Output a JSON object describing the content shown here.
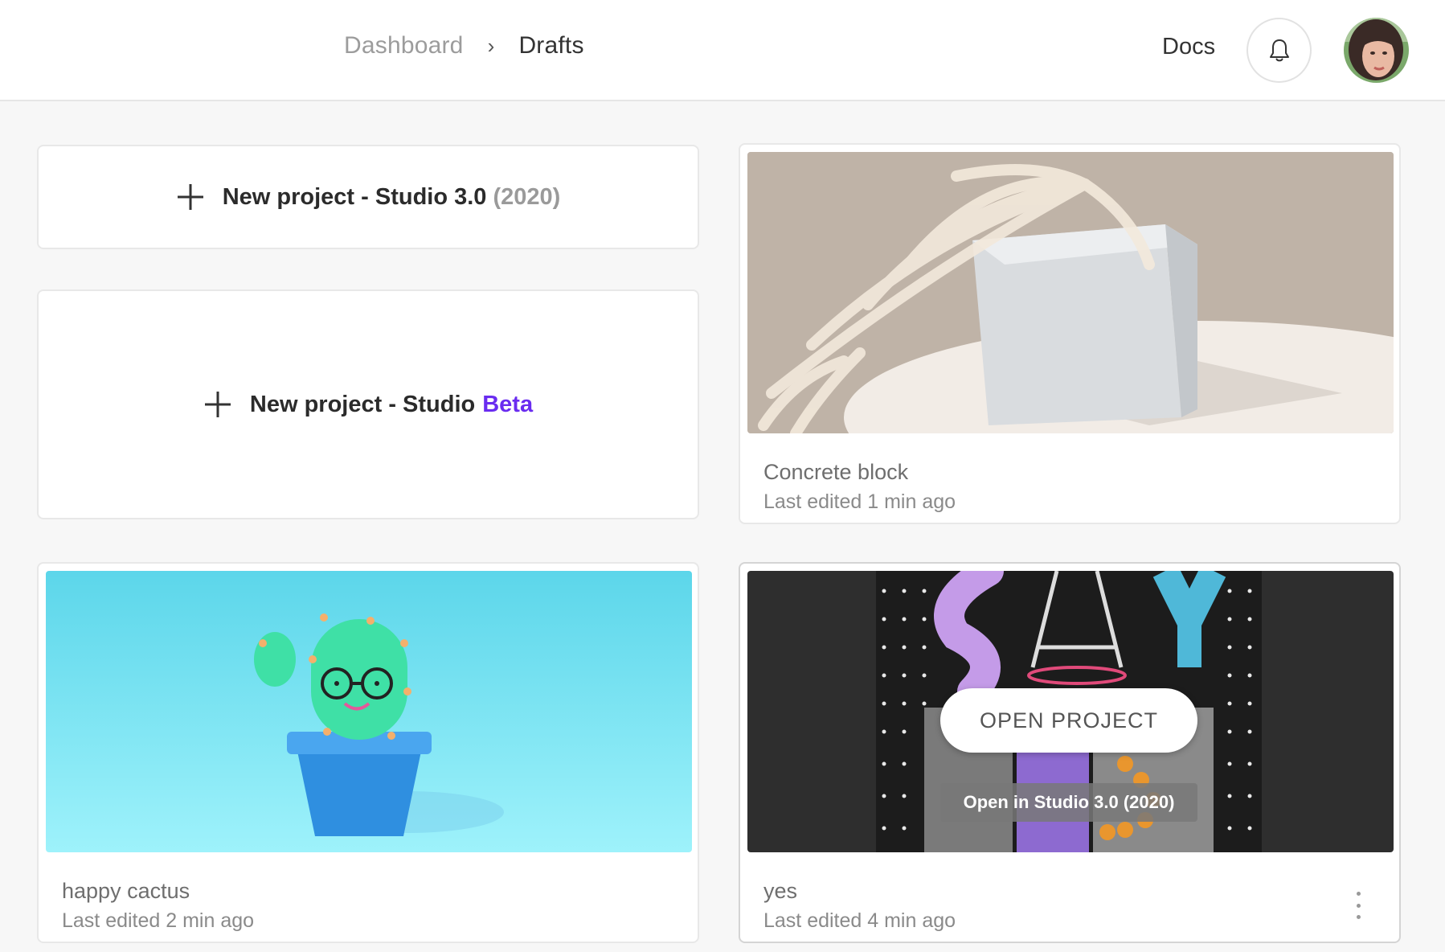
{
  "header": {
    "breadcrumb": {
      "parent": "Dashboard",
      "separator": "›",
      "current": "Drafts"
    },
    "docs_label": "Docs",
    "bell_icon": "bell-icon",
    "avatar_icon": "user-avatar"
  },
  "new_projects": {
    "studio3": {
      "prefix": "New project - Studio 3.0",
      "year": "(2020)"
    },
    "studio_beta": {
      "prefix": "New project - Studio",
      "beta": "Beta"
    }
  },
  "projects": [
    {
      "name": "Concrete block",
      "last_edited": "Last edited 1 min ago"
    },
    {
      "name": "happy cactus",
      "last_edited": "Last edited 2 min ago"
    },
    {
      "name": "yes",
      "last_edited": "Last edited 4 min ago"
    }
  ],
  "hover_actions": {
    "open_project": "OPEN PROJECT",
    "open_in_studio": "Open in Studio 3.0 (2020)"
  },
  "colors": {
    "accent": "#6a2cf0",
    "background": "#f7f7f7",
    "card": "#ffffff"
  }
}
